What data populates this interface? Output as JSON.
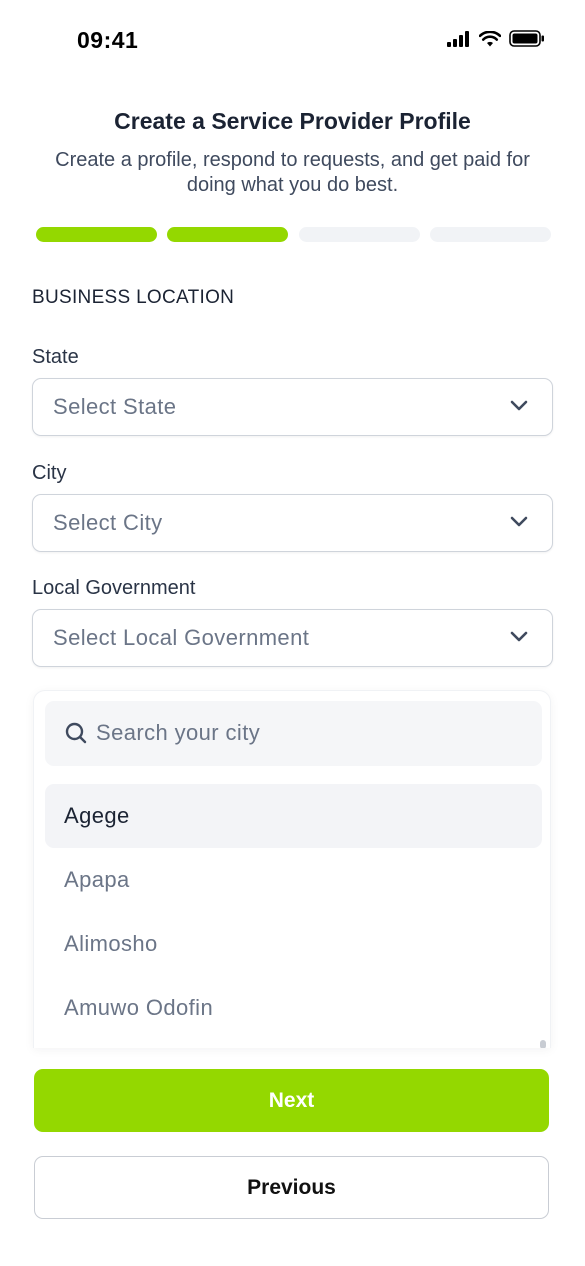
{
  "status_bar": {
    "time": "09:41",
    "icons": [
      "cellular-signal-icon",
      "wifi-icon",
      "battery-icon"
    ]
  },
  "header": {
    "title": "Create a Service Provider Profile",
    "subtitle": "Create a profile, respond to requests, and get paid for doing what you do best."
  },
  "progress": {
    "total_steps": 4,
    "completed_steps": 2,
    "active_color": "#94d800",
    "inactive_color": "#f1f3f6"
  },
  "form": {
    "section_title": "BUSINESS LOCATION",
    "fields": {
      "state": {
        "label": "State",
        "placeholder": "Select State"
      },
      "city": {
        "label": "City",
        "placeholder": "Select City"
      },
      "local_government": {
        "label": "Local Government",
        "placeholder": "Select Local Government"
      }
    }
  },
  "dropdown": {
    "search_placeholder": "Search your city",
    "options": [
      "Agege",
      "Apapa",
      "Alimosho",
      "Amuwo Odofin"
    ],
    "highlighted_option": "Agege"
  },
  "actions": {
    "next_label": "Next",
    "previous_label": "Previous"
  },
  "colors": {
    "primary": "#94d800",
    "text_dark": "#1b2333",
    "text_muted": "#6b7587"
  }
}
